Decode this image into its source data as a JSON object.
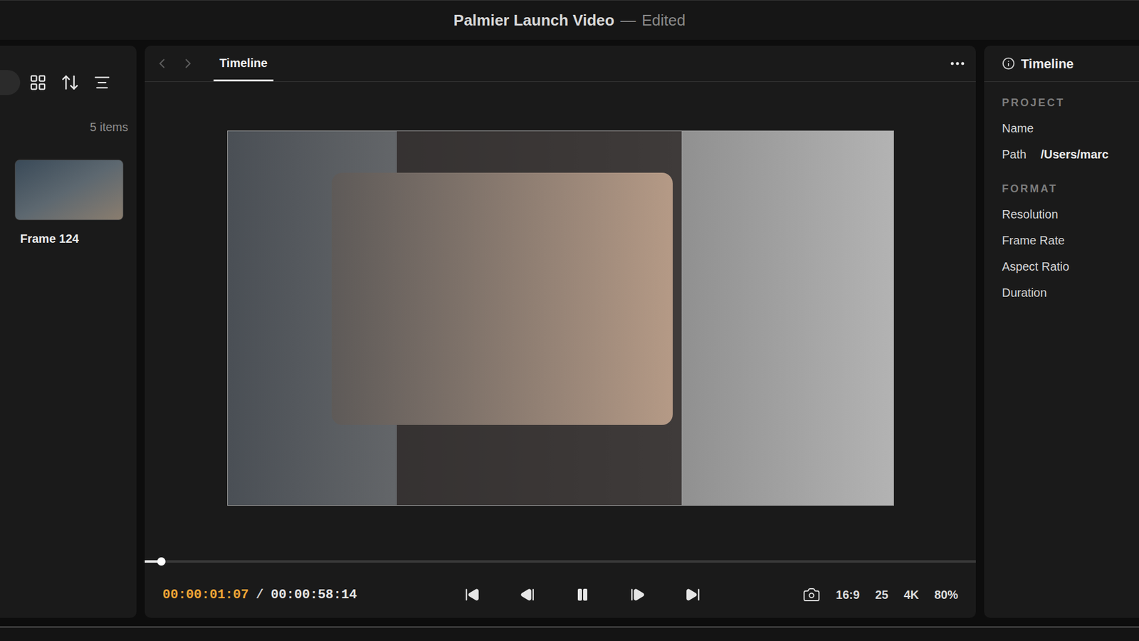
{
  "window": {
    "title": "Palmier Launch Video",
    "separator": "—",
    "status": "Edited"
  },
  "media_panel": {
    "count": "5 items",
    "items": [
      {
        "label": "Frame 124",
        "selected": false
      }
    ]
  },
  "viewer": {
    "tabs": [
      {
        "label": "Timeline",
        "selected": true
      }
    ],
    "playback": {
      "current": "00:00:01:07",
      "separator": "/",
      "total": "00:00:58:14",
      "level": 0.02,
      "playing": true
    },
    "format_badges": [
      "16:9",
      "25",
      "4K",
      "80%"
    ]
  },
  "inspector": {
    "title": "Timeline",
    "sections": [
      {
        "heading": "PROJECT",
        "rows": [
          {
            "label": "Name",
            "value": ""
          },
          {
            "label": "Path",
            "value": "/Users/marc"
          }
        ]
      },
      {
        "heading": "FORMAT",
        "rows": [
          {
            "label": "Resolution",
            "value": ""
          },
          {
            "label": "Frame Rate",
            "value": ""
          },
          {
            "label": "Aspect Ratio",
            "value": ""
          },
          {
            "label": "Duration",
            "value": ""
          }
        ]
      }
    ]
  }
}
